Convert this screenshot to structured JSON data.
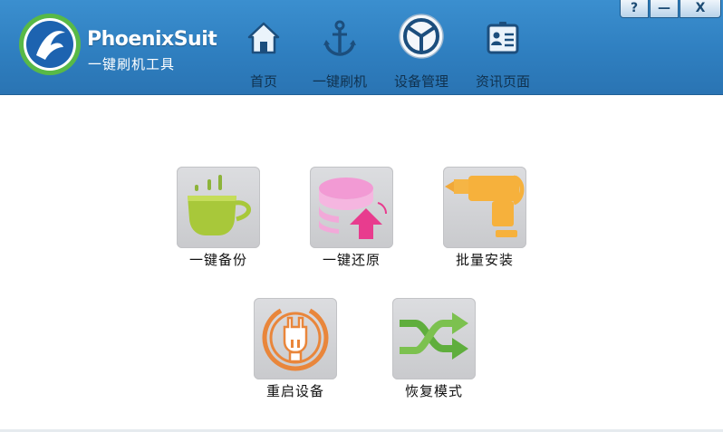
{
  "app": {
    "name": "PhoenixSuit",
    "subtitle": "一键刷机工具"
  },
  "window_controls": {
    "help": "?",
    "minimize": "—",
    "close": "X"
  },
  "nav": [
    {
      "label": "首页",
      "icon": "home-icon"
    },
    {
      "label": "一键刷机",
      "icon": "anchor-icon"
    },
    {
      "label": "设备管理",
      "icon": "device-manage-icon",
      "active": true
    },
    {
      "label": "资讯页面",
      "icon": "news-card-icon"
    }
  ],
  "tools": [
    {
      "label": "一键备份",
      "icon": "cup-backup-icon"
    },
    {
      "label": "一键还原",
      "icon": "database-restore-icon"
    },
    {
      "label": "批量安装",
      "icon": "drill-install-icon"
    },
    {
      "label": "重启设备",
      "icon": "power-plug-icon"
    },
    {
      "label": "恢复模式",
      "icon": "shuffle-recovery-icon"
    }
  ],
  "colors": {
    "header_blue": "#2f7fc0",
    "nav_text": "#10324f",
    "tile_bg": "#d4d5d8"
  }
}
